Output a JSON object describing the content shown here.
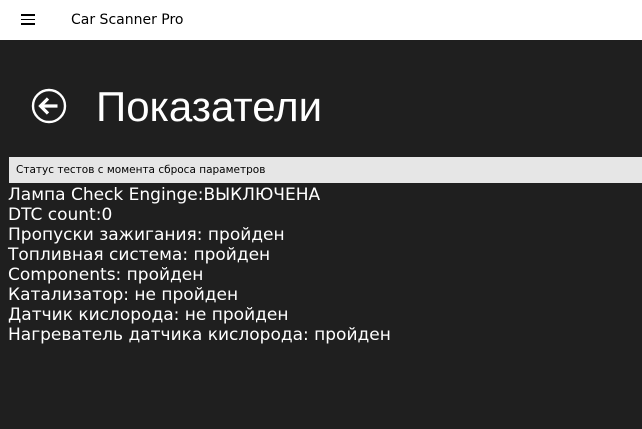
{
  "app": {
    "title": "Car Scanner Pro",
    "menu_icon": "hamburger-menu-icon"
  },
  "header": {
    "back_icon": "back-arrow-icon",
    "title": "Показатели"
  },
  "section": {
    "title": "Статус тестов с момента сброса параметров"
  },
  "status_items": [
    "Лампа Check Enginge:ВЫКЛЮЧЕНА",
    "DTC count:0",
    "Пропуски зажигания: пройден",
    "Топливная система: пройден",
    "Components: пройден",
    "Катализатор: не пройден",
    "Датчик кислорода: не пройден",
    "Нагреватель датчика кислорода: пройден"
  ],
  "colors": {
    "background": "#1f1f1f",
    "titlebar": "#ffffff",
    "section_header": "#e6e6e6",
    "text": "#ffffff"
  }
}
